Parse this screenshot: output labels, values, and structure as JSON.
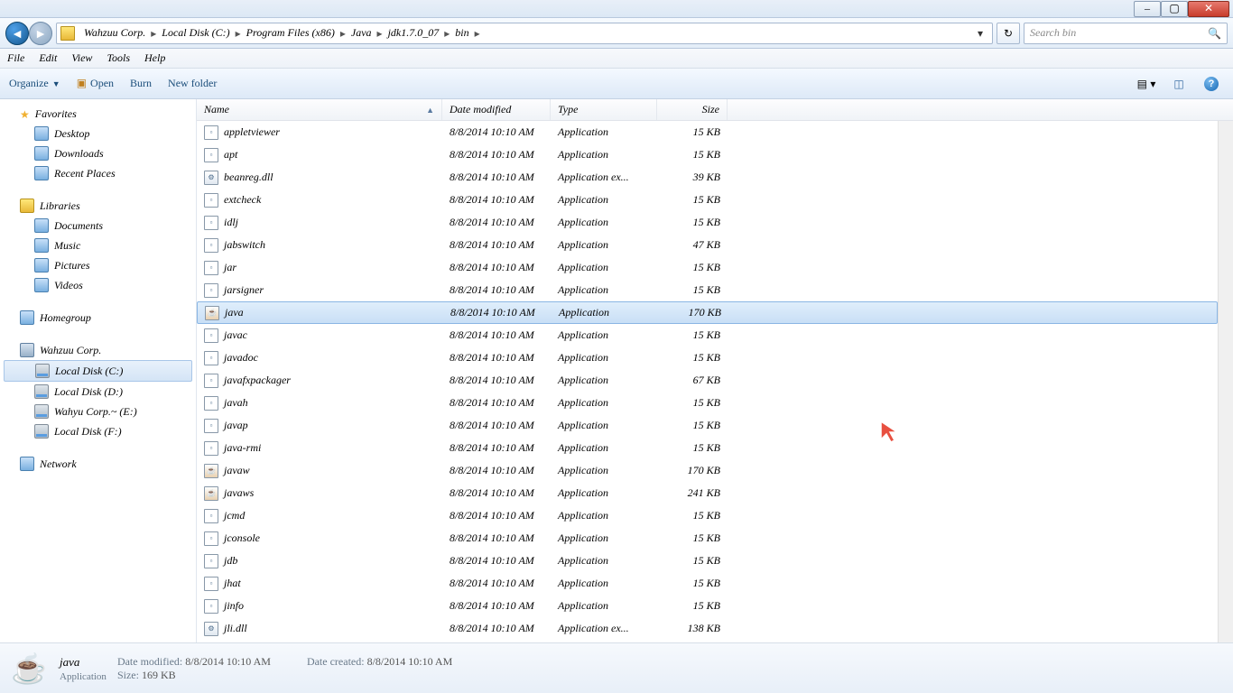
{
  "chrome": {
    "min": "–",
    "max": "▢",
    "close": "✕"
  },
  "nav": {
    "breadcrumbs": [
      "Wahzuu Corp.",
      "Local Disk (C:)",
      "Program Files (x86)",
      "Java",
      "jdk1.7.0_07",
      "bin"
    ],
    "search_placeholder": "Search bin"
  },
  "menu": [
    "File",
    "Edit",
    "View",
    "Tools",
    "Help"
  ],
  "toolbar": {
    "organize": "Organize",
    "open": "Open",
    "burn": "Burn",
    "newfolder": "New folder"
  },
  "sidebar": {
    "favorites": {
      "label": "Favorites",
      "items": [
        "Desktop",
        "Downloads",
        "Recent Places"
      ]
    },
    "libraries": {
      "label": "Libraries",
      "items": [
        "Documents",
        "Music",
        "Pictures",
        "Videos"
      ]
    },
    "homegroup": {
      "label": "Homegroup"
    },
    "computer": {
      "label": "Wahzuu Corp.",
      "items": [
        "Local Disk (C:)",
        "Local Disk (D:)",
        "Wahyu Corp.~ (E:)",
        "Local Disk (F:)"
      ],
      "selected": 0
    },
    "network": {
      "label": "Network"
    }
  },
  "columns": {
    "name": "Name",
    "date": "Date modified",
    "type": "Type",
    "size": "Size"
  },
  "files": [
    {
      "name": "appletviewer",
      "date": "8/8/2014 10:10 AM",
      "type": "Application",
      "size": "15 KB",
      "ic": "exe"
    },
    {
      "name": "apt",
      "date": "8/8/2014 10:10 AM",
      "type": "Application",
      "size": "15 KB",
      "ic": "exe"
    },
    {
      "name": "beanreg.dll",
      "date": "8/8/2014 10:10 AM",
      "type": "Application ex...",
      "size": "39 KB",
      "ic": "dll"
    },
    {
      "name": "extcheck",
      "date": "8/8/2014 10:10 AM",
      "type": "Application",
      "size": "15 KB",
      "ic": "exe"
    },
    {
      "name": "idlj",
      "date": "8/8/2014 10:10 AM",
      "type": "Application",
      "size": "15 KB",
      "ic": "exe"
    },
    {
      "name": "jabswitch",
      "date": "8/8/2014 10:10 AM",
      "type": "Application",
      "size": "47 KB",
      "ic": "exe"
    },
    {
      "name": "jar",
      "date": "8/8/2014 10:10 AM",
      "type": "Application",
      "size": "15 KB",
      "ic": "exe"
    },
    {
      "name": "jarsigner",
      "date": "8/8/2014 10:10 AM",
      "type": "Application",
      "size": "15 KB",
      "ic": "exe"
    },
    {
      "name": "java",
      "date": "8/8/2014 10:10 AM",
      "type": "Application",
      "size": "170 KB",
      "ic": "java",
      "sel": true
    },
    {
      "name": "javac",
      "date": "8/8/2014 10:10 AM",
      "type": "Application",
      "size": "15 KB",
      "ic": "exe"
    },
    {
      "name": "javadoc",
      "date": "8/8/2014 10:10 AM",
      "type": "Application",
      "size": "15 KB",
      "ic": "exe"
    },
    {
      "name": "javafxpackager",
      "date": "8/8/2014 10:10 AM",
      "type": "Application",
      "size": "67 KB",
      "ic": "exe"
    },
    {
      "name": "javah",
      "date": "8/8/2014 10:10 AM",
      "type": "Application",
      "size": "15 KB",
      "ic": "exe"
    },
    {
      "name": "javap",
      "date": "8/8/2014 10:10 AM",
      "type": "Application",
      "size": "15 KB",
      "ic": "exe"
    },
    {
      "name": "java-rmi",
      "date": "8/8/2014 10:10 AM",
      "type": "Application",
      "size": "15 KB",
      "ic": "exe"
    },
    {
      "name": "javaw",
      "date": "8/8/2014 10:10 AM",
      "type": "Application",
      "size": "170 KB",
      "ic": "java"
    },
    {
      "name": "javaws",
      "date": "8/8/2014 10:10 AM",
      "type": "Application",
      "size": "241 KB",
      "ic": "java"
    },
    {
      "name": "jcmd",
      "date": "8/8/2014 10:10 AM",
      "type": "Application",
      "size": "15 KB",
      "ic": "exe"
    },
    {
      "name": "jconsole",
      "date": "8/8/2014 10:10 AM",
      "type": "Application",
      "size": "15 KB",
      "ic": "exe"
    },
    {
      "name": "jdb",
      "date": "8/8/2014 10:10 AM",
      "type": "Application",
      "size": "15 KB",
      "ic": "exe"
    },
    {
      "name": "jhat",
      "date": "8/8/2014 10:10 AM",
      "type": "Application",
      "size": "15 KB",
      "ic": "exe"
    },
    {
      "name": "jinfo",
      "date": "8/8/2014 10:10 AM",
      "type": "Application",
      "size": "15 KB",
      "ic": "exe"
    },
    {
      "name": "jli.dll",
      "date": "8/8/2014 10:10 AM",
      "type": "Application ex...",
      "size": "138 KB",
      "ic": "dll"
    }
  ],
  "details": {
    "name": "java",
    "sub": "Application",
    "modified_label": "Date modified:",
    "modified": "8/8/2014 10:10 AM",
    "size_label": "Size:",
    "size": "169 KB",
    "created_label": "Date created:",
    "created": "8/8/2014 10:10 AM"
  }
}
